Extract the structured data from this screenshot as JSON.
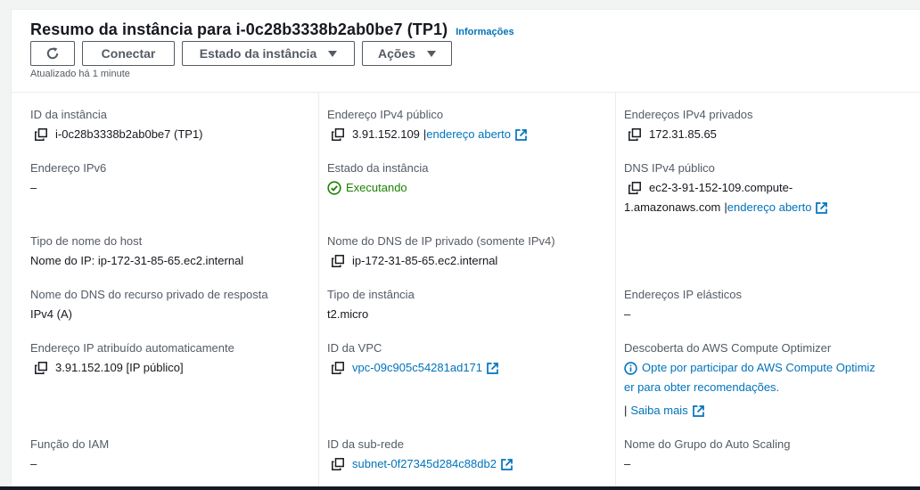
{
  "header": {
    "title": "Resumo da instância para i-0c28b3338b2ab0be7 (TP1)",
    "info_link": "Informações",
    "buttons": {
      "refresh_icon": "refresh-icon",
      "connect": "Conectar",
      "instance_state": "Estado da instância",
      "actions": "Ações"
    },
    "updated": "Atualizado há 1 minute"
  },
  "col1": {
    "instance_id": {
      "label": "ID da instância",
      "value": "i-0c28b3338b2ab0be7 (TP1)"
    },
    "ipv6": {
      "label": "Endereço IPv6",
      "value": "–"
    },
    "hostname_type": {
      "label": "Tipo de nome do host",
      "value": "Nome do IP: ip-172-31-85-65.ec2.internal"
    },
    "private_dns_answer": {
      "label": "Nome do DNS do recurso privado de resposta",
      "value": "IPv4 (A)"
    },
    "auto_ip": {
      "label": "Endereço IP atribuído automaticamente",
      "value": "3.91.152.109 [IP público]"
    },
    "iam_role": {
      "label": "Função do IAM",
      "value": "–"
    }
  },
  "col2": {
    "public_ipv4": {
      "label": "Endereço IPv4 público",
      "value": "3.91.152.109",
      "sep": "|",
      "link": "endereço aberto"
    },
    "instance_state": {
      "label": "Estado da instância",
      "value": "Executando"
    },
    "private_dns": {
      "label": "Nome do DNS de IP privado (somente IPv4)",
      "value": "ip-172-31-85-65.ec2.internal"
    },
    "instance_type": {
      "label": "Tipo de instância",
      "value": "t2.micro"
    },
    "vpc_id": {
      "label": "ID da VPC",
      "value": "vpc-09c905c54281ad171"
    },
    "subnet_id": {
      "label": "ID da sub-rede",
      "value": "subnet-0f27345d284c88db2"
    }
  },
  "col3": {
    "private_ipv4": {
      "label": "Endereços IPv4 privados",
      "value": "172.31.85.65"
    },
    "public_dns": {
      "label": "DNS IPv4 público",
      "value_line1": "ec2-3-91-152-109.compute-",
      "value_line2": "1.amazonaws.com",
      "sep": "|",
      "link": "endereço aberto"
    },
    "elastic_ip": {
      "label": "Endereços IP elásticos",
      "value": "–"
    },
    "compute_optimizer": {
      "label": "Descoberta do AWS Compute Optimizer",
      "line1": "Opte por participar do AWS Compute Optimiz",
      "line2": "er para obter recomendações.",
      "sep": "|",
      "learn_more": "Saiba mais"
    },
    "asg_name": {
      "label": "Nome do Grupo do Auto Scaling",
      "value": "–"
    }
  },
  "colors": {
    "link": "#0073bb",
    "success": "#1d8102",
    "label": "#545b64",
    "text": "#16191f"
  }
}
